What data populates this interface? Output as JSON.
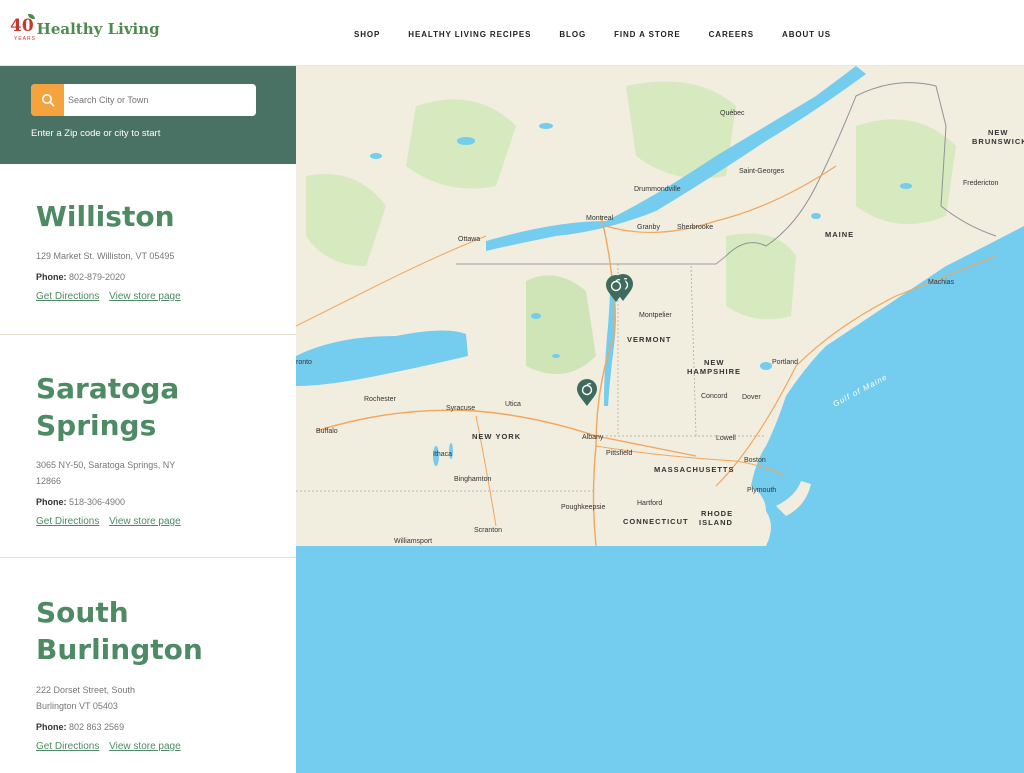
{
  "header": {
    "logo_number": "40",
    "logo_years": "YEARS",
    "logo_text": "Healthy Living",
    "nav": [
      "SHOP",
      "HEALTHY LIVING RECIPES",
      "BLOG",
      "FIND A STORE",
      "CAREERS",
      "ABOUT US"
    ]
  },
  "search": {
    "placeholder": "Search City or Town",
    "hint": "Enter a Zip code or city to start"
  },
  "stores": [
    {
      "name_line1": "Williston",
      "name_line2": "",
      "address_line1": "129 Market St. Williston, VT 05495",
      "address_line2": "",
      "phone_label": "Phone:",
      "phone": "802-879-2020",
      "directions": "Get Directions",
      "store_page": "View store page"
    },
    {
      "name_line1": "Saratoga",
      "name_line2": "Springs",
      "address_line1": "3065 NY-50, Saratoga Springs, NY",
      "address_line2": "12866",
      "phone_label": "Phone:",
      "phone": "518-306-4900",
      "directions": "Get Directions",
      "store_page": "View store page"
    },
    {
      "name_line1": "South",
      "name_line2": "Burlington",
      "address_line1": "222 Dorset Street, South",
      "address_line2": "Burlington VT 05403",
      "phone_label": "Phone:",
      "phone": "802 863 2569",
      "directions": "Get Directions",
      "store_page": "View store page"
    }
  ],
  "map": {
    "labels": {
      "quebec": "Québec",
      "new_brunswick_1": "NEW",
      "new_brunswick_2": "BRUNSWICK",
      "saint_georges": "Saint-Georges",
      "fredericton": "Fredericton",
      "drummondville": "Drummondville",
      "montreal": "Montreal",
      "ottawa": "Ottawa",
      "granby": "Granby",
      "sherbrooke": "Sherbrooke",
      "maine": "MAINE",
      "machias": "Machias",
      "montpelier": "Montpelier",
      "vermont": "VERMONT",
      "new_hampshire_1": "NEW",
      "new_hampshire_2": "HAMPSHIRE",
      "portland": "Portland",
      "gulf_of_maine": "Gulf of Maine",
      "toronto": "ronto",
      "rochester": "Rochester",
      "syracuse": "Syracuse",
      "utica": "Utica",
      "buffalo": "Buffalo",
      "new_york": "NEW YORK",
      "albany": "Albany",
      "concord": "Concord",
      "dover": "Dover",
      "lowell": "Lowell",
      "boston": "Boston",
      "ithaca": "Ithaca",
      "pittsfield": "Pittsfield",
      "massachusetts": "MASSACHUSETTS",
      "binghamton": "Binghamton",
      "plymouth": "Plymouth",
      "hartford": "Hartford",
      "poughkeepsie": "Poughkeepsie",
      "connecticut": "CONNECTICUT",
      "rhode_island_1": "RHODE",
      "rhode_island_2": "ISLAND",
      "scranton": "Scranton",
      "williamsport": "Williamsport"
    }
  },
  "colors": {
    "brand_green": "#4e8a63",
    "search_panel": "#4a7264",
    "search_button": "#f4a33f",
    "water": "#74ccee",
    "land": "#f1eddf",
    "pin": "#3e6b5c"
  }
}
